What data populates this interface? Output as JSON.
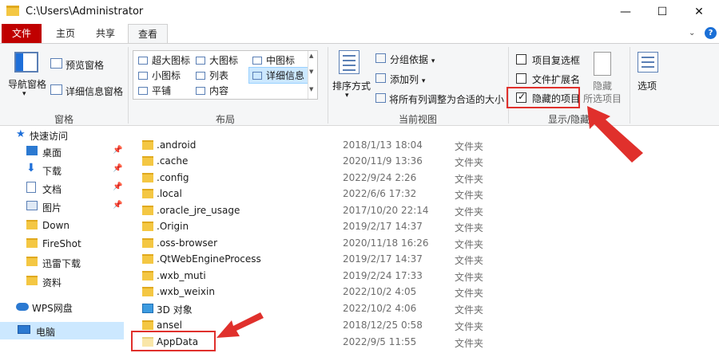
{
  "window": {
    "title": "C:\\Users\\Administrator",
    "minimize": "—",
    "maximize": "☐",
    "close": "✕"
  },
  "tabs": {
    "file": "文件",
    "home": "主页",
    "share": "共享",
    "view": "查看"
  },
  "ribbon": {
    "pane_group": {
      "nav_pane": "导航窗格",
      "preview_pane": "预览窗格",
      "details_pane": "详细信息窗格",
      "label": "窗格"
    },
    "layout_group": {
      "items": {
        "extra_large": "超大图标",
        "large": "大图标",
        "medium": "中图标",
        "small": "小图标",
        "list": "列表",
        "details": "详细信息",
        "tiles": "平铺",
        "content": "内容"
      },
      "selected": "details",
      "label": "布局"
    },
    "current_view_group": {
      "sort_by": "排序方式",
      "group_by": "分组依据",
      "add_columns": "添加列",
      "fit_columns": "将所有列调整为合适的大小",
      "label": "当前视图"
    },
    "show_hide_group": {
      "item_checkboxes": "项目复选框",
      "item_checkboxes_checked": false,
      "file_extensions": "文件扩展名",
      "file_extensions_checked": false,
      "hidden_items": "隐藏的项目",
      "hidden_items_checked": true,
      "hide_selected_line1": "隐藏",
      "hide_selected_line2": "所选项目",
      "label": "显示/隐藏"
    },
    "options": "选项"
  },
  "nav": {
    "items": [
      {
        "label": "快速访问",
        "icon": "star-icon"
      },
      {
        "label": "桌面",
        "icon": "desktop-icon",
        "pinned": true
      },
      {
        "label": "下载",
        "icon": "download-icon",
        "pinned": true
      },
      {
        "label": "文档",
        "icon": "document-icon",
        "pinned": true
      },
      {
        "label": "图片",
        "icon": "picture-icon",
        "pinned": true
      },
      {
        "label": "Down",
        "icon": "folder-icon"
      },
      {
        "label": "FireShot",
        "icon": "folder-icon"
      },
      {
        "label": "迅雷下载",
        "icon": "folder-icon"
      },
      {
        "label": "资料",
        "icon": "folder-icon"
      },
      {
        "label": "WPS网盘",
        "icon": "cloud-icon"
      },
      {
        "label": "电脑",
        "icon": "computer-icon",
        "selected": true
      }
    ],
    "pin_glyph": "📌"
  },
  "files": [
    {
      "name": ".android",
      "date": "2018/1/13 18:04",
      "type": "文件夹"
    },
    {
      "name": ".cache",
      "date": "2020/11/9 13:36",
      "type": "文件夹"
    },
    {
      "name": ".config",
      "date": "2022/9/24 2:26",
      "type": "文件夹"
    },
    {
      "name": ".local",
      "date": "2022/6/6 17:32",
      "type": "文件夹"
    },
    {
      "name": ".oracle_jre_usage",
      "date": "2017/10/20 22:14",
      "type": "文件夹"
    },
    {
      "name": ".Origin",
      "date": "2019/2/17 14:37",
      "type": "文件夹"
    },
    {
      "name": ".oss-browser",
      "date": "2020/11/18 16:26",
      "type": "文件夹"
    },
    {
      "name": ".QtWebEngineProcess",
      "date": "2019/2/17 14:37",
      "type": "文件夹"
    },
    {
      "name": ".wxb_muti",
      "date": "2019/2/24 17:33",
      "type": "文件夹"
    },
    {
      "name": ".wxb_weixin",
      "date": "2022/10/2 4:05",
      "type": "文件夹"
    },
    {
      "name": "3D 对象",
      "date": "2022/10/2 4:06",
      "type": "文件夹"
    },
    {
      "name": "ansel",
      "date": "2018/12/25 0:58",
      "type": "文件夹"
    },
    {
      "name": "AppData",
      "date": "2022/9/5 11:55",
      "type": "文件夹"
    }
  ],
  "colors": {
    "accent_red": "#c00000",
    "annotation_red": "#e0302c",
    "folder_yellow": "#f4c743",
    "selection_blue": "#cce8ff"
  }
}
